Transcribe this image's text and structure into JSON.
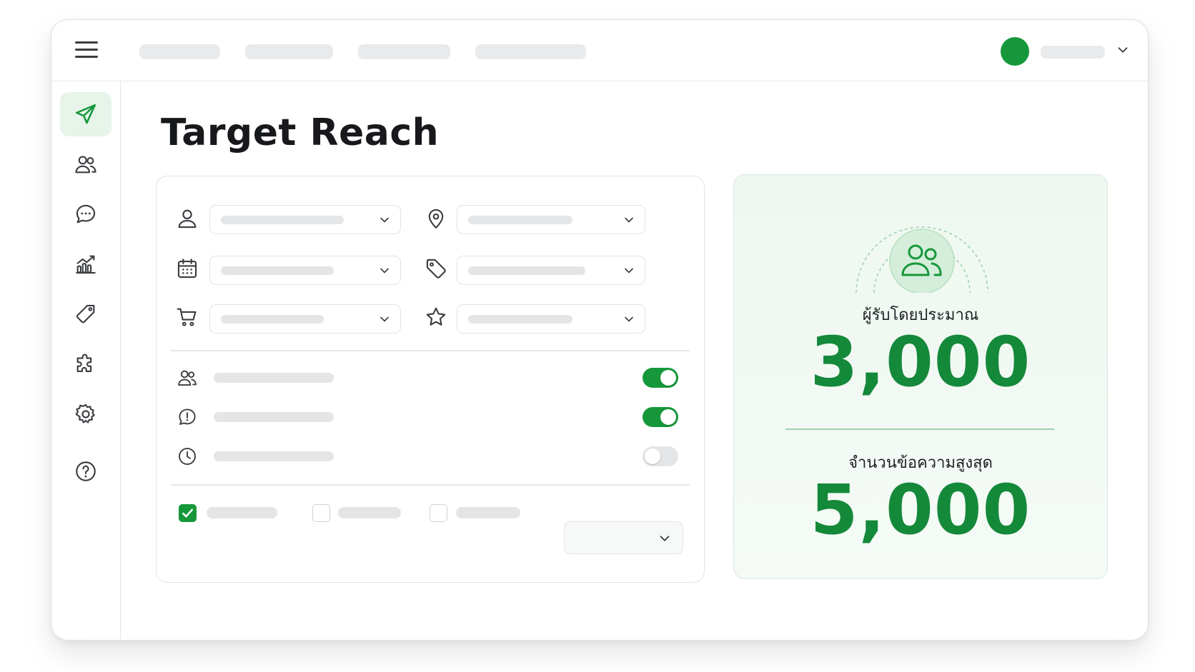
{
  "page": {
    "title": "Target Reach"
  },
  "reach": {
    "estimated_recipients_label": "ผู้รับโดยประมาณ",
    "estimated_recipients_value": "3,000",
    "max_messages_label": "จำนวนข้อความสูงสุด",
    "max_messages_value": "5,000"
  },
  "toggles": [
    {
      "icon": "users-icon",
      "on": true
    },
    {
      "icon": "alert-chat-icon",
      "on": true
    },
    {
      "icon": "clock-icon",
      "on": false
    }
  ],
  "checkboxes": [
    {
      "checked": true
    },
    {
      "checked": false
    },
    {
      "checked": false
    }
  ],
  "sidebar": {
    "items": [
      "send-icon",
      "users-icon",
      "chat-icon",
      "analytics-icon",
      "tag-icon",
      "puzzle-icon",
      "gear-icon",
      "help-icon"
    ],
    "active": "send-icon"
  },
  "colors": {
    "accent": "#16983a",
    "accent_dark": "#14893a",
    "accent_soft": "#e7f4ea"
  }
}
